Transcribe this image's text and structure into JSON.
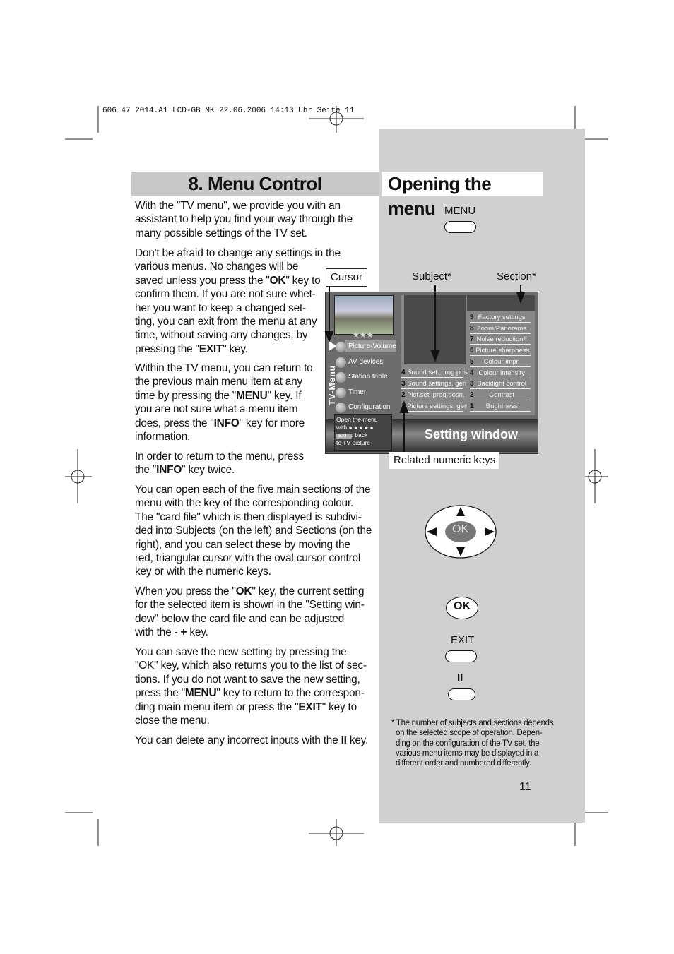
{
  "slug": "606 47 2014.A1 LCD-GB  MK  22.06.2006  14:13 Uhr  Seite 11",
  "left_title": "8. Menu Control",
  "right_title": "Opening the menu",
  "paragraphs": [
    [
      [
        [
          "With the \"TV menu\", we provide you with an"
        ]
      ],
      [
        [
          "assistant to help you find your way through the"
        ]
      ],
      [
        [
          "many possible settings of the TV set."
        ]
      ]
    ],
    [
      [
        [
          "Don't be afraid to change any settings in the"
        ]
      ],
      [
        [
          "various menus. No changes will be"
        ]
      ],
      [
        [
          "saved unless you press the \""
        ],
        [
          "OK",
          1
        ],
        [
          "\" key to"
        ]
      ],
      [
        [
          "confirm them. If you are not sure whet-"
        ]
      ],
      [
        [
          "her you want to keep a changed set-"
        ]
      ],
      [
        [
          "ting, you can exit from the menu at any"
        ]
      ],
      [
        [
          "time, without saving any changes, by"
        ]
      ],
      [
        [
          "pressing the \""
        ],
        [
          "EXIT",
          1
        ],
        [
          "\" key."
        ]
      ]
    ],
    [
      [
        [
          "Within the TV menu, you can return to"
        ]
      ],
      [
        [
          "the previous main menu item at any"
        ]
      ],
      [
        [
          "time by pressing the \""
        ],
        [
          "MENU",
          1
        ],
        [
          "\" key. If"
        ]
      ],
      [
        [
          "you are not sure what a menu item"
        ]
      ],
      [
        [
          "does, press the \""
        ],
        [
          "INFO",
          1
        ],
        [
          "\" key for more"
        ]
      ],
      [
        [
          "information."
        ]
      ]
    ],
    [
      [
        [
          "In order to return to the menu, press"
        ]
      ],
      [
        [
          "the \""
        ],
        [
          "INFO",
          1
        ],
        [
          "\" key twice."
        ]
      ]
    ],
    [
      [
        [
          "You can open each of the five main sections of the"
        ]
      ],
      [
        [
          "menu with the key of the corresponding colour."
        ]
      ],
      [
        [
          "The \"card file\" which is then displayed is subdivi-"
        ]
      ],
      [
        [
          "ded into Subjects (on the left) and Sections (on the"
        ]
      ],
      [
        [
          "right), and you can select these by moving the"
        ]
      ],
      [
        [
          "red, triangular cursor with the oval cursor control"
        ]
      ],
      [
        [
          "key or with the numeric keys."
        ]
      ]
    ],
    [
      [
        [
          "When you press the \""
        ],
        [
          "OK",
          1
        ],
        [
          "\" key, the current setting"
        ]
      ],
      [
        [
          "for the selected item is shown in the \"Setting win-"
        ]
      ],
      [
        [
          "dow\" below the card file and can be adjusted"
        ]
      ],
      [
        [
          "with the "
        ],
        [
          "- +",
          1
        ],
        [
          " key."
        ]
      ]
    ],
    [
      [
        [
          "You can save the new setting by pressing the"
        ]
      ],
      [
        [
          "\"OK\" key, which also returns you to the list of sec-"
        ]
      ],
      [
        [
          "tions. If you do not want to save the new setting,"
        ]
      ],
      [
        [
          "press the \""
        ],
        [
          "MENU",
          1
        ],
        [
          "\" key to return to the correspon-"
        ]
      ],
      [
        [
          "ding main menu item or press the \""
        ],
        [
          "EXIT",
          1
        ],
        [
          "\" key to"
        ]
      ],
      [
        [
          "close the menu."
        ]
      ]
    ],
    [
      [
        [
          "You can delete any incorrect inputs with the "
        ],
        [
          "II",
          1
        ],
        [
          " key."
        ]
      ]
    ]
  ],
  "labels": {
    "menu_key": "MENU",
    "cursor": "Cursor",
    "subject": "Subject*",
    "section": "Section*",
    "related": "Related numeric keys",
    "exit_key": "EXIT",
    "ii_key": "II",
    "ok": "OK",
    "ok_key": "OK"
  },
  "tv_menu": {
    "side_title": "TV-Menu",
    "stars": "★★★",
    "main_items": [
      "Picture-Volume",
      "AV devices",
      "Station table",
      "Timer",
      "Configuration"
    ],
    "hint": [
      "Open the menu",
      "with",
      "EXIT",
      ": back",
      "to TV picture"
    ],
    "subjects": [
      {
        "n": "4",
        "t": "Sound set.,prog.posn"
      },
      {
        "n": "3",
        "t": "Sound settings, gen."
      },
      {
        "n": "2",
        "t": "Pict.set.,prog.posn."
      },
      {
        "n": "1",
        "t": "Picture settings, gen."
      }
    ],
    "sections": [
      {
        "n": "9",
        "t": "Factory settings"
      },
      {
        "n": "8",
        "t": "Zoom/Panorama"
      },
      {
        "n": "7",
        "t": "Noise reduction³⁾"
      },
      {
        "n": "6",
        "t": "Picture sharpness"
      },
      {
        "n": "5",
        "t": "Colour impr."
      },
      {
        "n": "4",
        "t": "Colour intensity"
      },
      {
        "n": "3",
        "t": "Backlight control"
      },
      {
        "n": "2",
        "t": "Contrast"
      },
      {
        "n": "1",
        "t": "Brightness"
      }
    ],
    "setting_window": "Setting window"
  },
  "footnote": [
    "* The number of subjects and sections depends",
    "on the selected scope of operation. Depen-",
    "ding on the configuration of the TV set, the",
    "various menu items may be displayed in a",
    "different order and numbered differently."
  ],
  "page_number": "11",
  "colors": {
    "panel": "#d0d0d0",
    "menu_bg": "#6c6c6c"
  }
}
